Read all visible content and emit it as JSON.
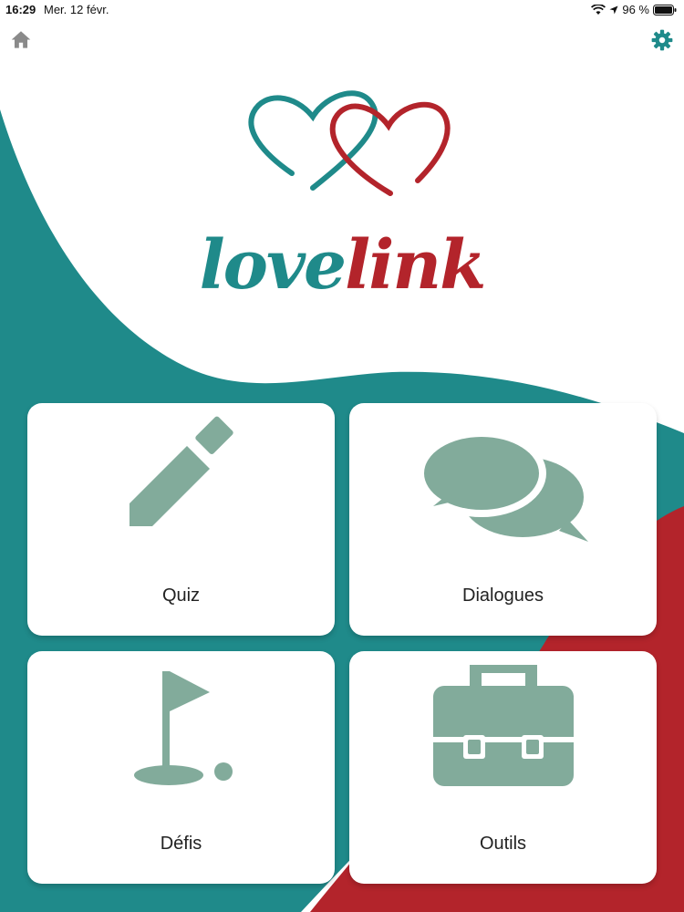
{
  "status_bar": {
    "time": "16:29",
    "date": "Mer. 12 févr.",
    "battery": "96 %"
  },
  "nav": {
    "home_icon": "home-icon",
    "settings_icon": "gear-icon"
  },
  "brand": {
    "word_love": "love",
    "word_link": "link",
    "colors": {
      "teal": "#1f8a8a",
      "red": "#b3242b",
      "tile_icon": "#82ab9b"
    }
  },
  "menu": {
    "tiles": [
      {
        "label": "Quiz",
        "icon": "pencil-icon"
      },
      {
        "label": "Dialogues",
        "icon": "speech-bubbles-icon"
      },
      {
        "label": "Défis",
        "icon": "golf-flag-icon"
      },
      {
        "label": "Outils",
        "icon": "toolbox-icon"
      }
    ]
  }
}
